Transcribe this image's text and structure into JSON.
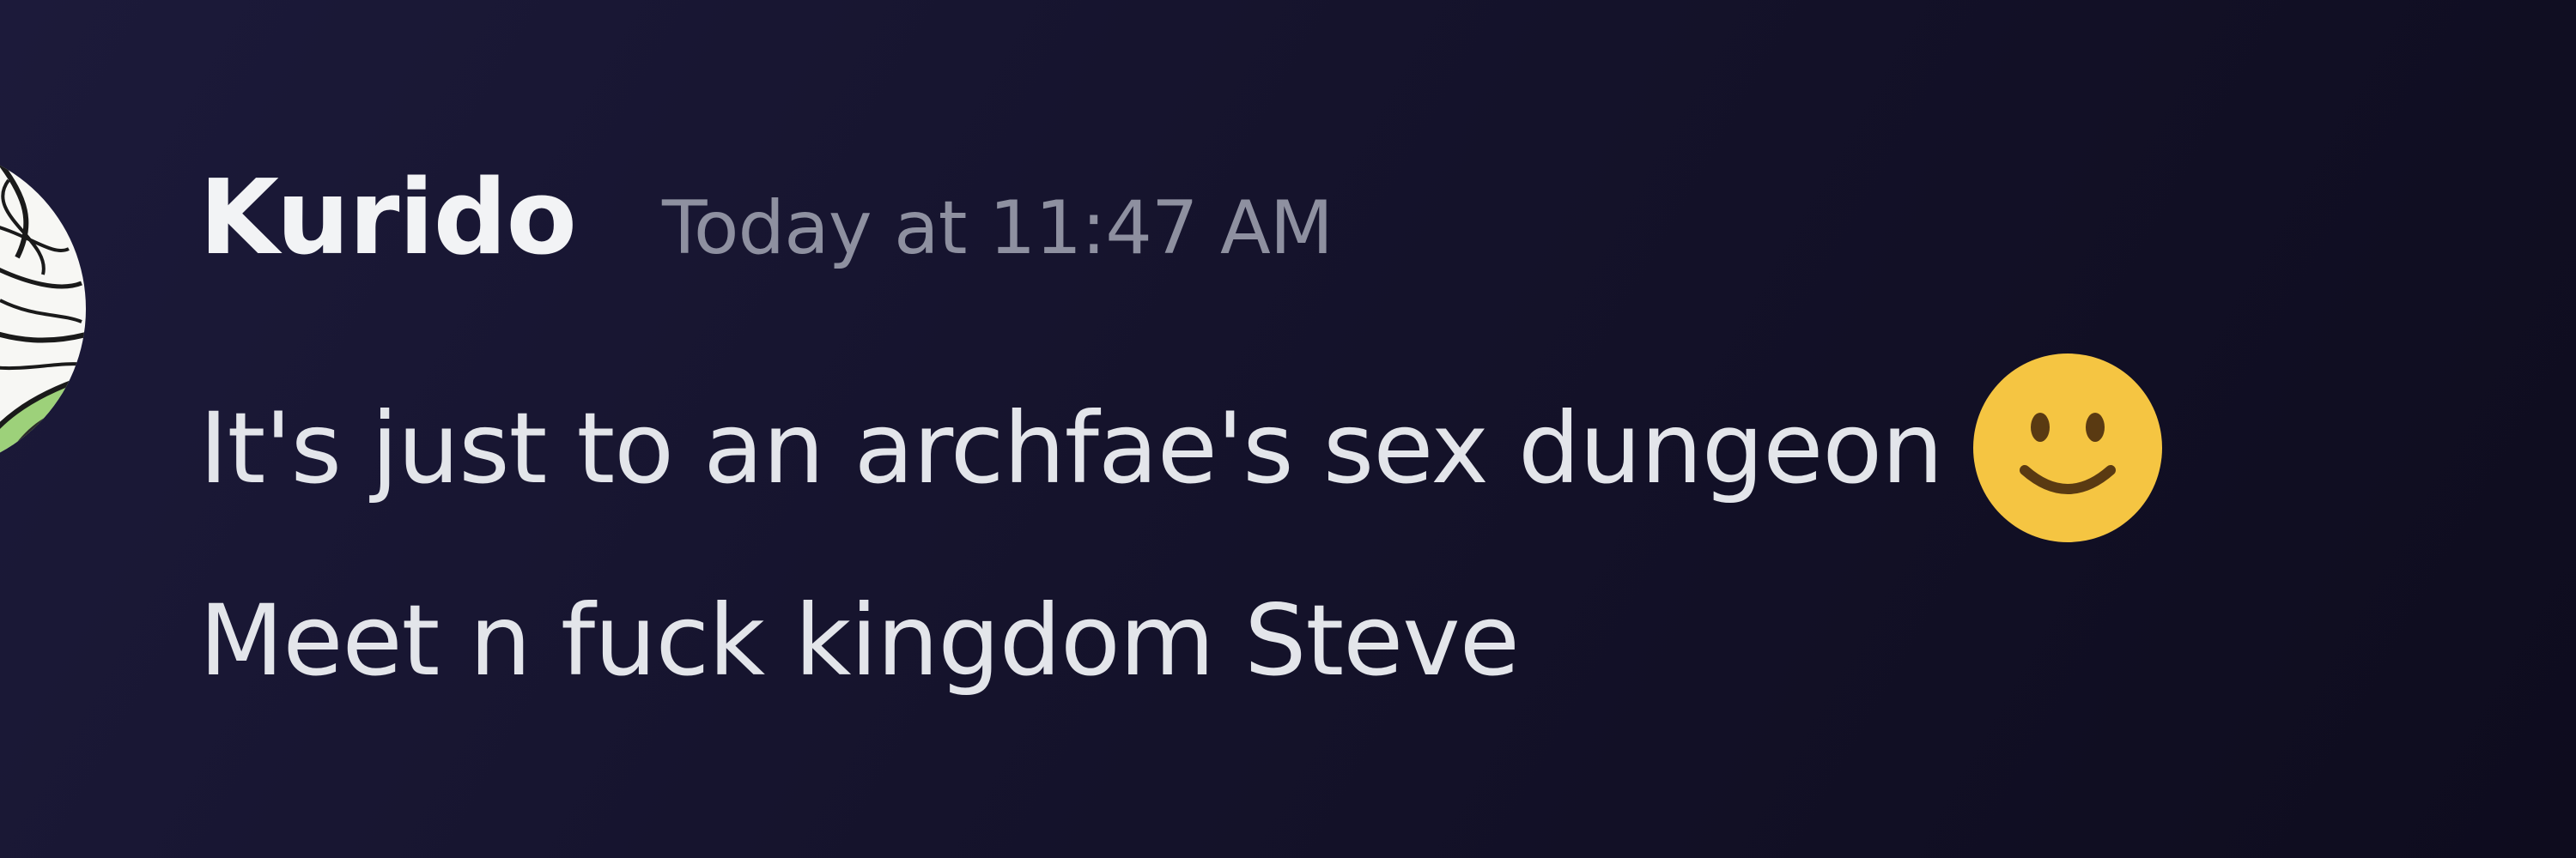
{
  "message": {
    "author": "Kurido",
    "timestamp": "Today at 11:47 AM",
    "lines": [
      "It's just to an archfae's sex dungeon",
      "Meet n fuck kingdom Steve"
    ],
    "emoji": "slightly-smiling-face"
  },
  "colors": {
    "username": "#f2f3f5",
    "timestamp": "#8e90a0",
    "text": "#e3e5ea",
    "emoji_face": "#f5c542",
    "emoji_features": "#5a3a12"
  }
}
